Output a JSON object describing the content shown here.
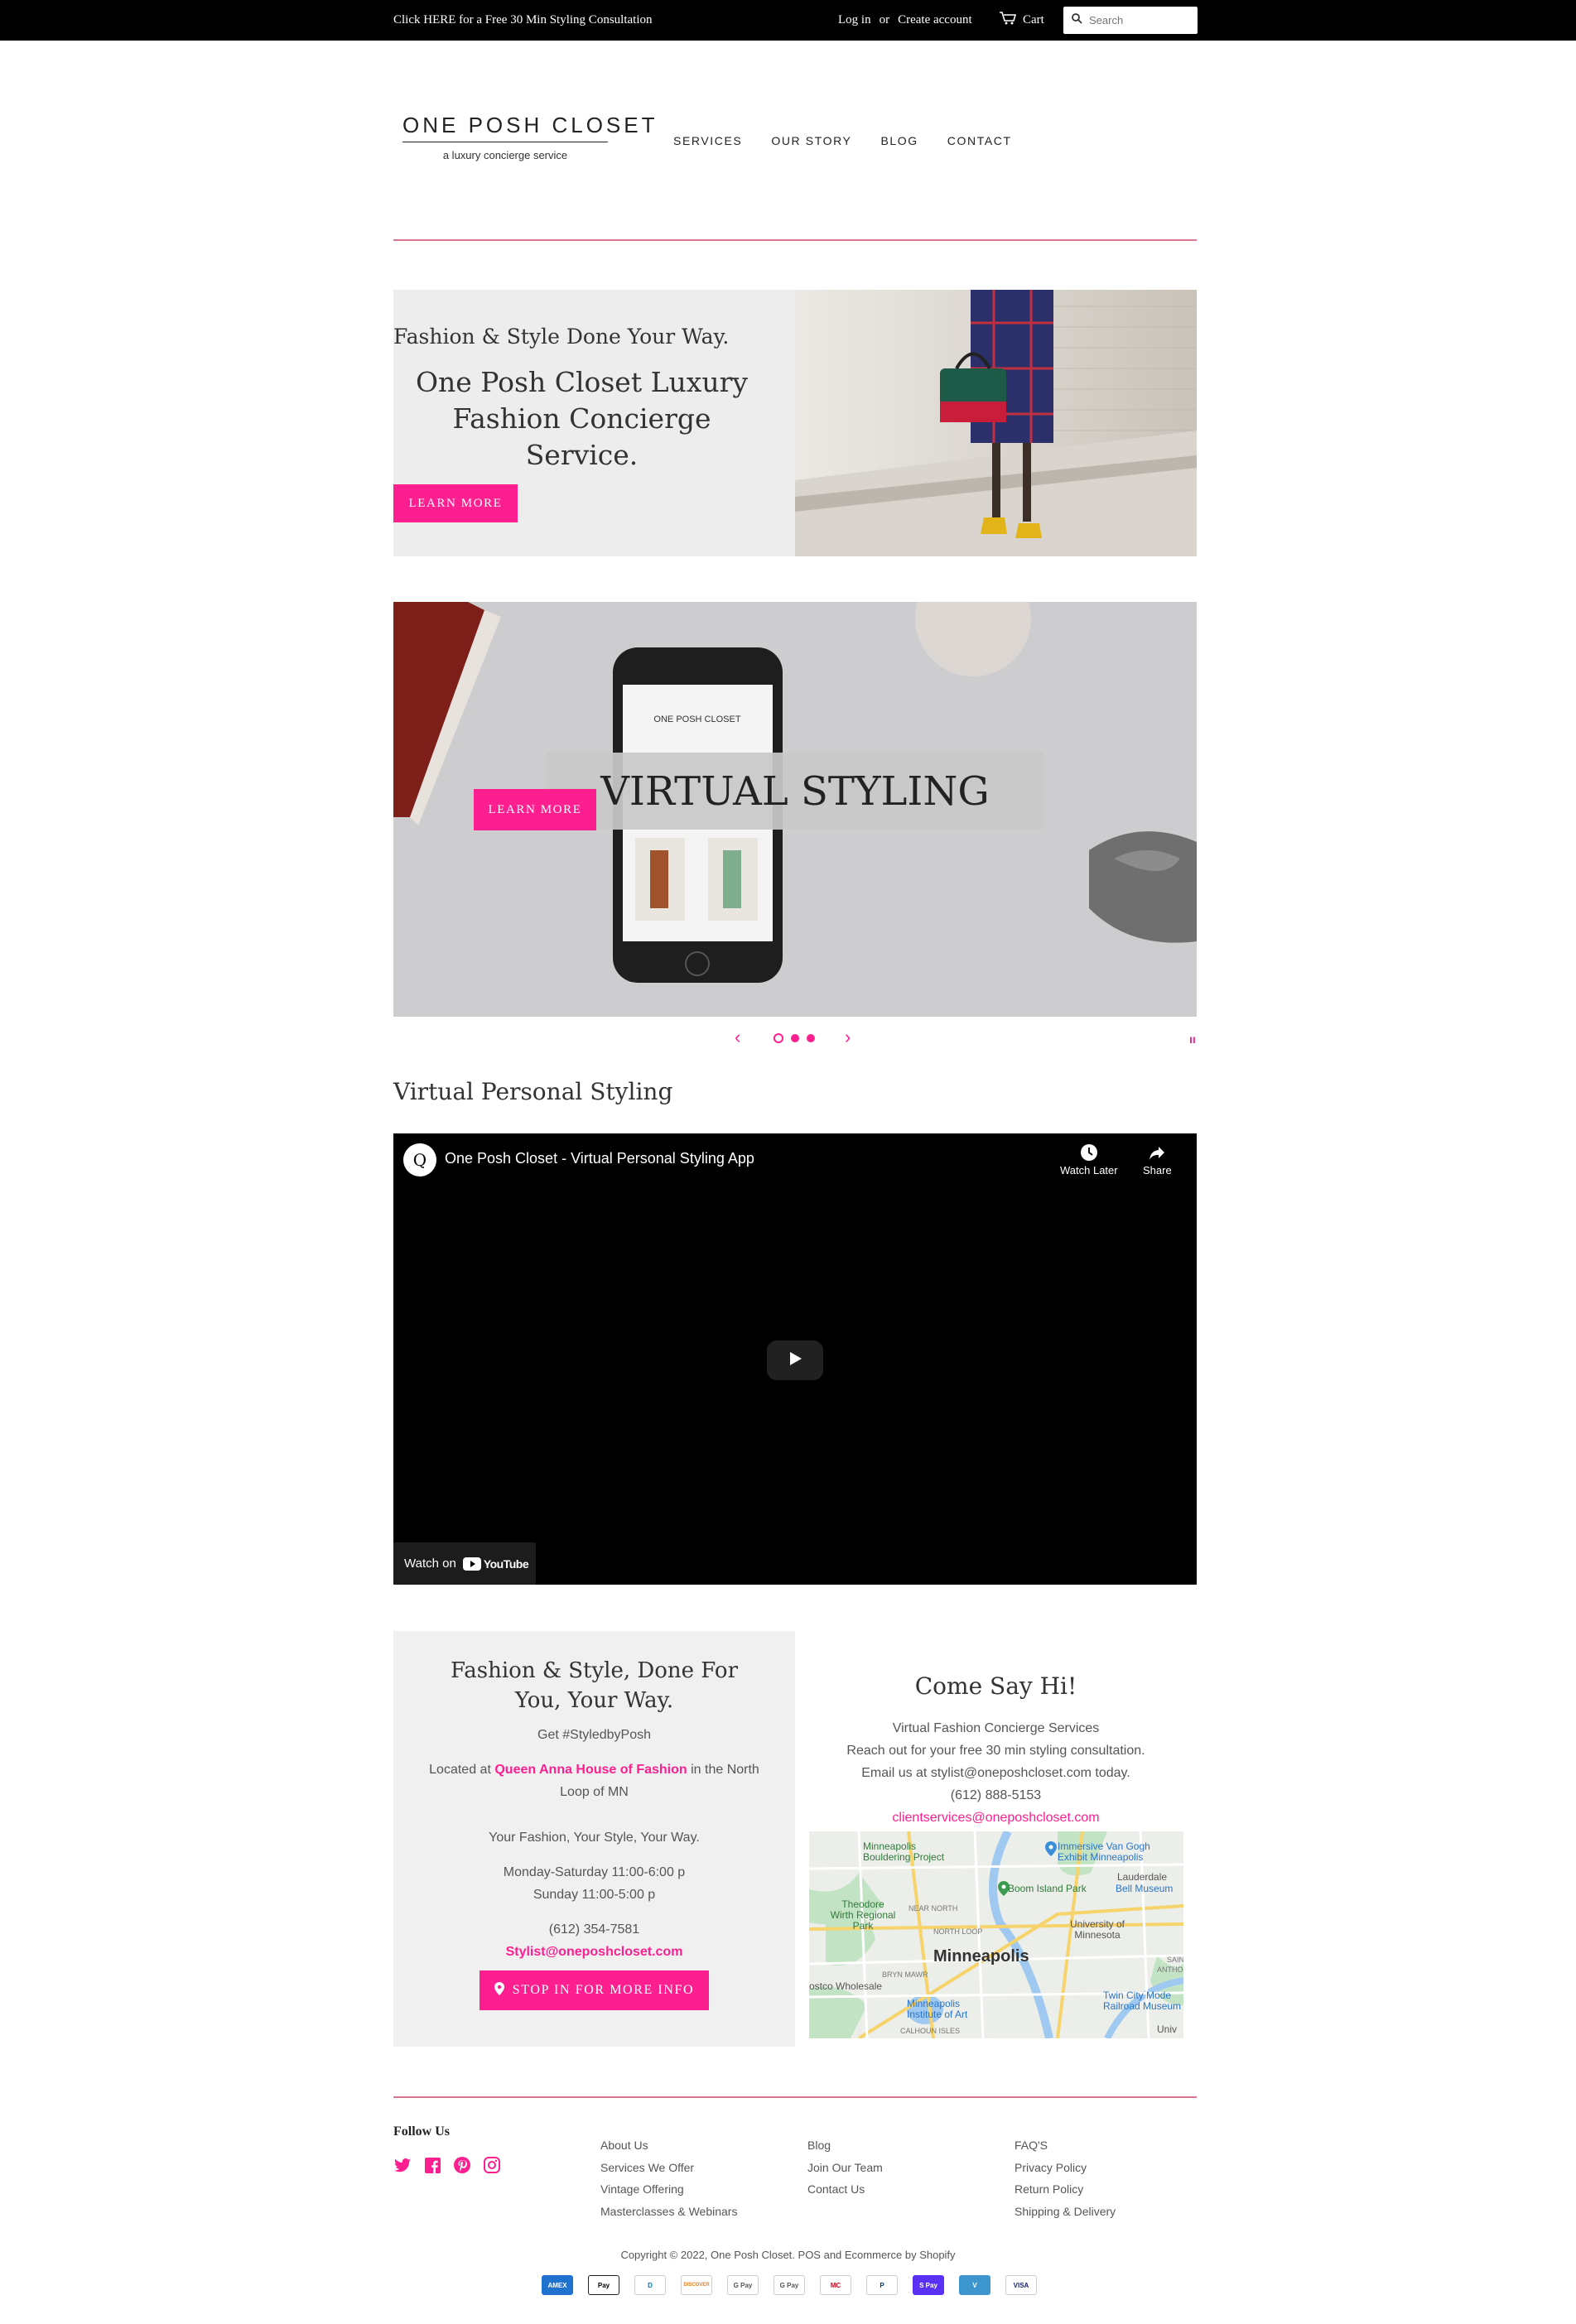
{
  "topbar": {
    "promo": "Click HERE for a Free 30 Min Styling Consultation",
    "login": "Log in",
    "or": "or",
    "create_account": "Create account",
    "cart": "Cart",
    "search_placeholder": "Search"
  },
  "header": {
    "logo_name": "ONE POSH CLOSET",
    "logo_tagline": "a luxury concierge service",
    "nav": [
      "SERVICES",
      "OUR STORY",
      "BLOG",
      "CONTACT"
    ]
  },
  "hero": {
    "kicker": "Fashion & Style Done Your Way.",
    "headline": "One Posh Closet Luxury Fashion Concierge Service.",
    "button": "LEARN MORE"
  },
  "slideshow": {
    "title": "VIRTUAL STYLING",
    "button": "LEARN MORE",
    "slide_count": 3,
    "active_slide": 1
  },
  "video_section": {
    "title": "Virtual Personal Styling",
    "video_title": "One Posh Closet - Virtual Personal Styling App",
    "watch_later": "Watch Later",
    "share": "Share",
    "watch_on": "Watch on",
    "youtube": "YouTube"
  },
  "info": {
    "heading": "Fashion & Style, Done For You, Your Way.",
    "hashtag": "Get #StyledbyPosh",
    "located_prefix": "Located at",
    "location_link": "Queen Anna House of Fashion",
    "located_suffix": "in the North Loop of MN",
    "tagline": "Your Fashion, Your Style, Your Way.",
    "hours_weekday": "Monday-Saturday 11:00-6:00 p",
    "hours_sunday": "Sunday 11:00-5:00 p",
    "phone": "(612) 354-7581",
    "email": "Stylist@oneposhcloset.com",
    "button": "STOP IN FOR MORE INFO"
  },
  "contact": {
    "heading": "Come Say Hi!",
    "line1": "Virtual Fashion Concierge Services",
    "line2": "Reach out for your free 30 min styling consultation.",
    "line3": "Email us at stylist@oneposhcloset.com today.",
    "phone": "(612) 888-5153",
    "email": "clientservices@oneposhcloset.com",
    "map_labels": {
      "city": "Minneapolis",
      "bouldering": "Minneapolis Bouldering Project",
      "van_gogh": "Immersive Van Gogh Exhibit Minneapolis",
      "boom_island": "Boom Island Park",
      "lauderdale": "Lauderdale",
      "bell": "Bell Museum",
      "theodore": "Theodore Wirth Regional Park",
      "near_north": "NEAR NORTH",
      "north_loop": "NORTH LOOP",
      "umn": "University of Minnesota",
      "bryn_mawr": "BRYN MAWR",
      "costco": "ostco Wholesale",
      "institute": "Minneapolis Institute of Art",
      "calhoun": "CALHOUN ISLES",
      "twin_city": "Twin City Mode Railroad Museum",
      "univ": "Univ",
      "saint": "SAIN",
      "anthony": "ANTHONY"
    }
  },
  "footer": {
    "follow": "Follow Us",
    "social": [
      "twitter-icon",
      "facebook-icon",
      "pinterest-icon",
      "instagram-icon"
    ],
    "col1": [
      "About Us",
      "Services We Offer",
      "Vintage Offering",
      "Masterclasses & Webinars"
    ],
    "col2": [
      "Blog",
      "Join Our Team",
      "Contact Us"
    ],
    "col3": [
      "FAQ'S",
      "Privacy Policy",
      "Return Policy",
      "Shipping & Delivery"
    ],
    "copyright": "Copyright © 2022, One Posh Closet. POS and Ecommerce by Shopify",
    "payments": [
      "AMEX",
      "Pay",
      "D",
      "DISCOVER",
      "G Pay",
      "G Pay",
      "MC",
      "P",
      "S Pay",
      "V",
      "VISA"
    ]
  },
  "colors": {
    "accent_pink": "#fd1f8f",
    "rule_pink": "#d4778f",
    "topbar": "#000000"
  }
}
